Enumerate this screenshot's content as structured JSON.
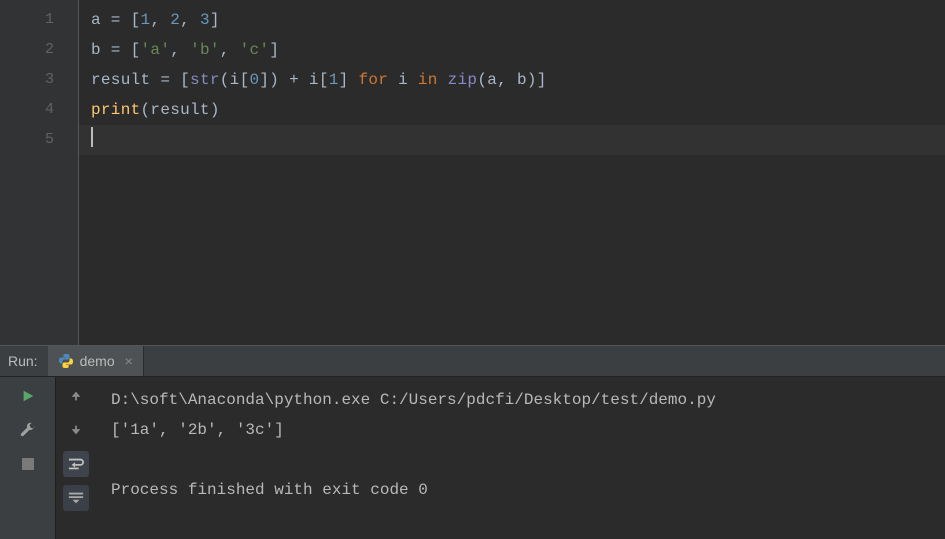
{
  "editor": {
    "lines": [
      {
        "ln": "1",
        "tokens": [
          {
            "c": "t-var",
            "t": "a"
          },
          {
            "c": "t-op",
            "t": " = "
          },
          {
            "c": "t-br",
            "t": "["
          },
          {
            "c": "t-num",
            "t": "1"
          },
          {
            "c": "t-op",
            "t": ", "
          },
          {
            "c": "t-num",
            "t": "2"
          },
          {
            "c": "t-op",
            "t": ", "
          },
          {
            "c": "t-num",
            "t": "3"
          },
          {
            "c": "t-br",
            "t": "]"
          }
        ]
      },
      {
        "ln": "2",
        "tokens": [
          {
            "c": "t-var",
            "t": "b"
          },
          {
            "c": "t-op",
            "t": " = "
          },
          {
            "c": "t-br",
            "t": "["
          },
          {
            "c": "t-str",
            "t": "'a'"
          },
          {
            "c": "t-op",
            "t": ", "
          },
          {
            "c": "t-str",
            "t": "'b'"
          },
          {
            "c": "t-op",
            "t": ", "
          },
          {
            "c": "t-str",
            "t": "'c'"
          },
          {
            "c": "t-br",
            "t": "]"
          }
        ]
      },
      {
        "ln": "3",
        "tokens": [
          {
            "c": "t-var",
            "t": "result"
          },
          {
            "c": "t-op",
            "t": " = "
          },
          {
            "c": "t-br",
            "t": "["
          },
          {
            "c": "t-bfn",
            "t": "str"
          },
          {
            "c": "t-br",
            "t": "("
          },
          {
            "c": "t-var",
            "t": "i"
          },
          {
            "c": "t-br",
            "t": "["
          },
          {
            "c": "t-num",
            "t": "0"
          },
          {
            "c": "t-br",
            "t": "]"
          },
          {
            "c": "t-br",
            "t": ")"
          },
          {
            "c": "t-op",
            "t": " + "
          },
          {
            "c": "t-var",
            "t": "i"
          },
          {
            "c": "t-br",
            "t": "["
          },
          {
            "c": "t-num",
            "t": "1"
          },
          {
            "c": "t-br",
            "t": "]"
          },
          {
            "c": "t-op",
            "t": " "
          },
          {
            "c": "t-kw",
            "t": "for"
          },
          {
            "c": "t-op",
            "t": " "
          },
          {
            "c": "t-var",
            "t": "i"
          },
          {
            "c": "t-op",
            "t": " "
          },
          {
            "c": "t-kw",
            "t": "in"
          },
          {
            "c": "t-op",
            "t": " "
          },
          {
            "c": "t-bfn",
            "t": "zip"
          },
          {
            "c": "t-br",
            "t": "("
          },
          {
            "c": "t-var",
            "t": "a"
          },
          {
            "c": "t-op",
            "t": ", "
          },
          {
            "c": "t-var",
            "t": "b"
          },
          {
            "c": "t-br",
            "t": ")"
          },
          {
            "c": "t-br",
            "t": "]"
          }
        ]
      },
      {
        "ln": "4",
        "tokens": [
          {
            "c": "t-fn",
            "t": "print"
          },
          {
            "c": "t-br",
            "t": "("
          },
          {
            "c": "t-var",
            "t": "result"
          },
          {
            "c": "t-br",
            "t": ")"
          }
        ]
      },
      {
        "ln": "5",
        "current": true,
        "caret": true,
        "tokens": []
      }
    ]
  },
  "run": {
    "title": "Run:",
    "tab": {
      "label": "demo"
    },
    "console": {
      "lines": [
        "D:\\soft\\Anaconda\\python.exe C:/Users/pdcfi/Desktop/test/demo.py",
        "['1a', '2b', '3c']",
        "",
        "Process finished with exit code 0"
      ]
    },
    "icons": {
      "rerun": "rerun-icon",
      "wrench": "wrench-icon",
      "stop": "stop-icon",
      "up": "up-arrow-icon",
      "down": "down-arrow-icon",
      "softwrap": "soft-wrap-icon",
      "scrollend": "scroll-to-end-icon"
    }
  }
}
